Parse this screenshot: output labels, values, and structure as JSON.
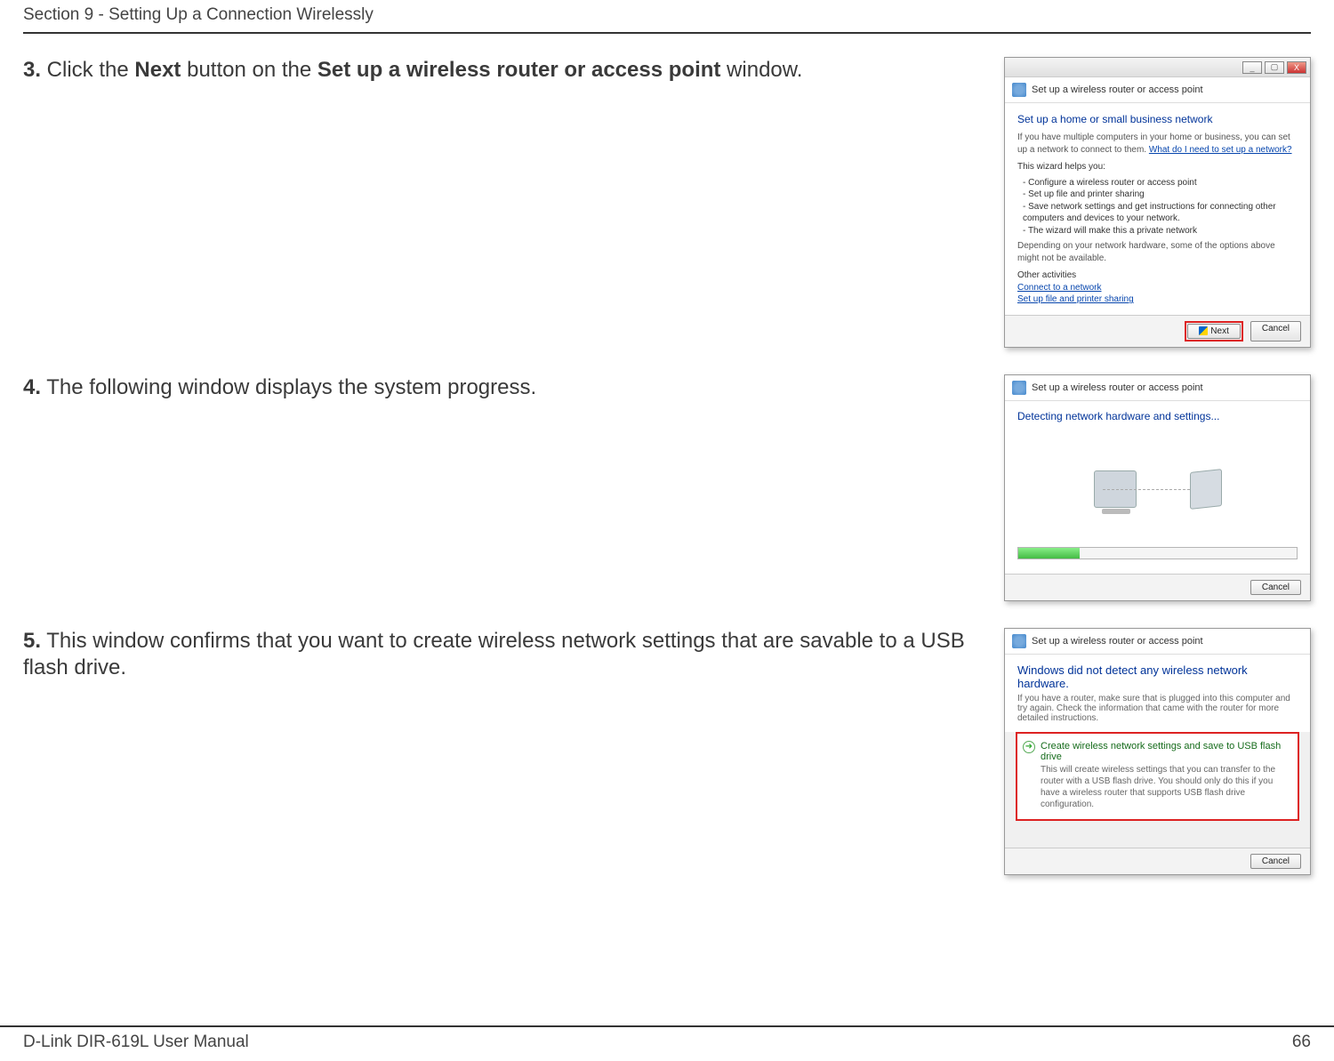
{
  "header": {
    "section": "Section 9 - Setting Up a Connection Wirelessly"
  },
  "footer": {
    "manual": "D-Link DIR-619L User Manual",
    "page": "66"
  },
  "steps": {
    "s3": {
      "num": "3.",
      "pre": " Click the ",
      "bold1": "Next",
      "mid": " button on the ",
      "bold2": "Set up a wireless router or access point",
      "post": " window."
    },
    "s4": {
      "num": "4.",
      "text": " The following window displays the system progress."
    },
    "s5": {
      "num": "5.",
      "text": " This window confirms that you want to create wireless network settings that are savable to a USB flash drive."
    }
  },
  "shot1": {
    "bread": "Set up a wireless router or access point",
    "lead": "Set up a home or small business network",
    "intro": "If you have multiple computers in your home or business, you can set up a network to connect to them. ",
    "introLink": "What do I need to set up a network?",
    "helps": "This wizard helps you:",
    "b1": "Configure a wireless router or access point",
    "b2": "Set up file and printer sharing",
    "b3": "Save network settings and get instructions for connecting other computers and devices to your network.",
    "b4": "The wizard will make this a private network",
    "depend": "Depending on your network hardware, some of the options above might not be available.",
    "other": "Other activities",
    "link1": "Connect to a network",
    "link2": "Set up file and printer sharing",
    "next": "Next",
    "cancel": "Cancel"
  },
  "shot2": {
    "bread": "Set up a wireless router or access point",
    "detect": "Detecting network hardware and settings...",
    "cancel": "Cancel"
  },
  "shot3": {
    "bread": "Set up a wireless router or access point",
    "lead": "Windows did not detect any wireless network hardware.",
    "sub": "If you have a router, make sure that is plugged into this computer and try again. Check the information that came with the router for more detailed instructions.",
    "optTitle": "Create wireless network settings and save to USB flash drive",
    "optDesc": "This will create wireless settings that you can transfer to the router with a USB flash drive. You should only do this if you have a wireless router that supports USB flash drive configuration.",
    "cancel": "Cancel"
  }
}
